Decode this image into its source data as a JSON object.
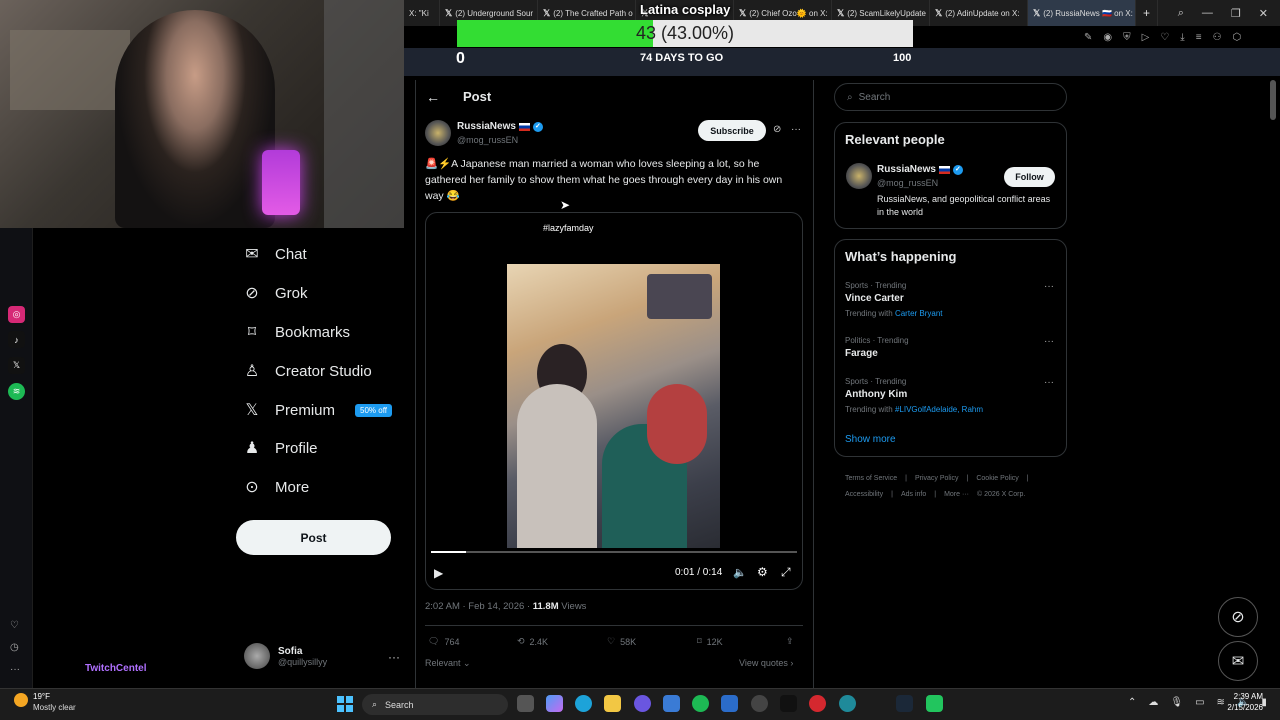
{
  "browser": {
    "tabs": [
      {
        "label": "X: \"Ki",
        "active": false
      },
      {
        "label": "(2) Underground Sour",
        "active": false
      },
      {
        "label": "(2) The Crafted Path o",
        "active": false
      },
      {
        "label": "",
        "active": false
      },
      {
        "label": "(2) Chief Ozo🌞 on X:",
        "active": false
      },
      {
        "label": "(2) ScamLikelyUpdate",
        "active": false
      },
      {
        "label": "(2) AdinUpdate on X: ",
        "active": false
      },
      {
        "label": "(2) RussiaNews 🇷🇺 on X: \"",
        "active": true
      }
    ]
  },
  "goal": {
    "title": "Latina cosplay",
    "current": 43,
    "percent_text": "43 (43.00%)",
    "fraction": 0.43,
    "min": "0",
    "days_left": "74 DAYS TO GO",
    "max": "100",
    "fill_color": "#33dd33"
  },
  "left_nav": {
    "items": [
      {
        "label": "Chat",
        "icon": "chat-icon"
      },
      {
        "label": "Grok",
        "icon": "grok-icon"
      },
      {
        "label": "Bookmarks",
        "icon": "bookmark-icon"
      },
      {
        "label": "Creator Studio",
        "icon": "creator-studio-icon"
      },
      {
        "label": "Premium",
        "icon": "x-premium-icon",
        "badge": "50% off"
      },
      {
        "label": "Profile",
        "icon": "profile-icon"
      },
      {
        "label": "More",
        "icon": "more-circle-icon"
      }
    ],
    "post_button": "Post",
    "profile": {
      "name": "Sofia",
      "handle": "@quillysillyy"
    }
  },
  "stream": {
    "twitch_name": "TwitchCentel"
  },
  "post": {
    "header": "Post",
    "author_name": "RussiaNews",
    "author_handle": "@mog_russEN",
    "subscribe_label": "Subscribe",
    "text": "🚨⚡A Japanese man married a woman who loves sleeping a lot, so he gathered her family to show them what he goes through every day in his own way 😂",
    "media_caption": "#lazyfamday",
    "video": {
      "timecode": "0:01 / 0:14",
      "progress": 0.095
    },
    "timestamp": "2:02 AM · Feb 14, 2026 · ",
    "views_count": "11.8M",
    "views_label": " Views",
    "stats": {
      "replies": "764",
      "reposts": "2.4K",
      "likes": "58K",
      "bookmarks": "12K"
    },
    "sort_label": "Relevant",
    "view_quotes": "View quotes"
  },
  "right": {
    "search_placeholder": "Search",
    "relevant_people_title": "Relevant people",
    "person": {
      "name": "RussiaNews",
      "handle": "@mog_russEN",
      "follow_label": "Follow",
      "bio": "RussiaNews, and geopolitical conflict areas in the world"
    },
    "happening_title": "What’s happening",
    "trends": [
      {
        "category": "Sports · Trending",
        "name": "Vince Carter",
        "with_prefix": "Trending with ",
        "with": "Carter Bryant"
      },
      {
        "category": "Politics · Trending",
        "name": "Farage",
        "with_prefix": "",
        "with": ""
      },
      {
        "category": "Sports · Trending",
        "name": "Anthony Kim",
        "with_prefix": "Trending with ",
        "with": "#LIVGolfAdelaide, Rahm"
      }
    ],
    "show_more": "Show more",
    "footer": [
      "Terms of Service",
      "|",
      "Privacy Policy",
      "|",
      "Cookie Policy",
      "|",
      "Accessibility",
      "|",
      "Ads info",
      "|",
      "More ···",
      "© 2026 X Corp."
    ]
  },
  "taskbar": {
    "weather_temp": "19°F",
    "weather_desc": "Mostly clear",
    "search_label": "Search",
    "time": "2:39 AM",
    "date": "2/15/2026"
  }
}
